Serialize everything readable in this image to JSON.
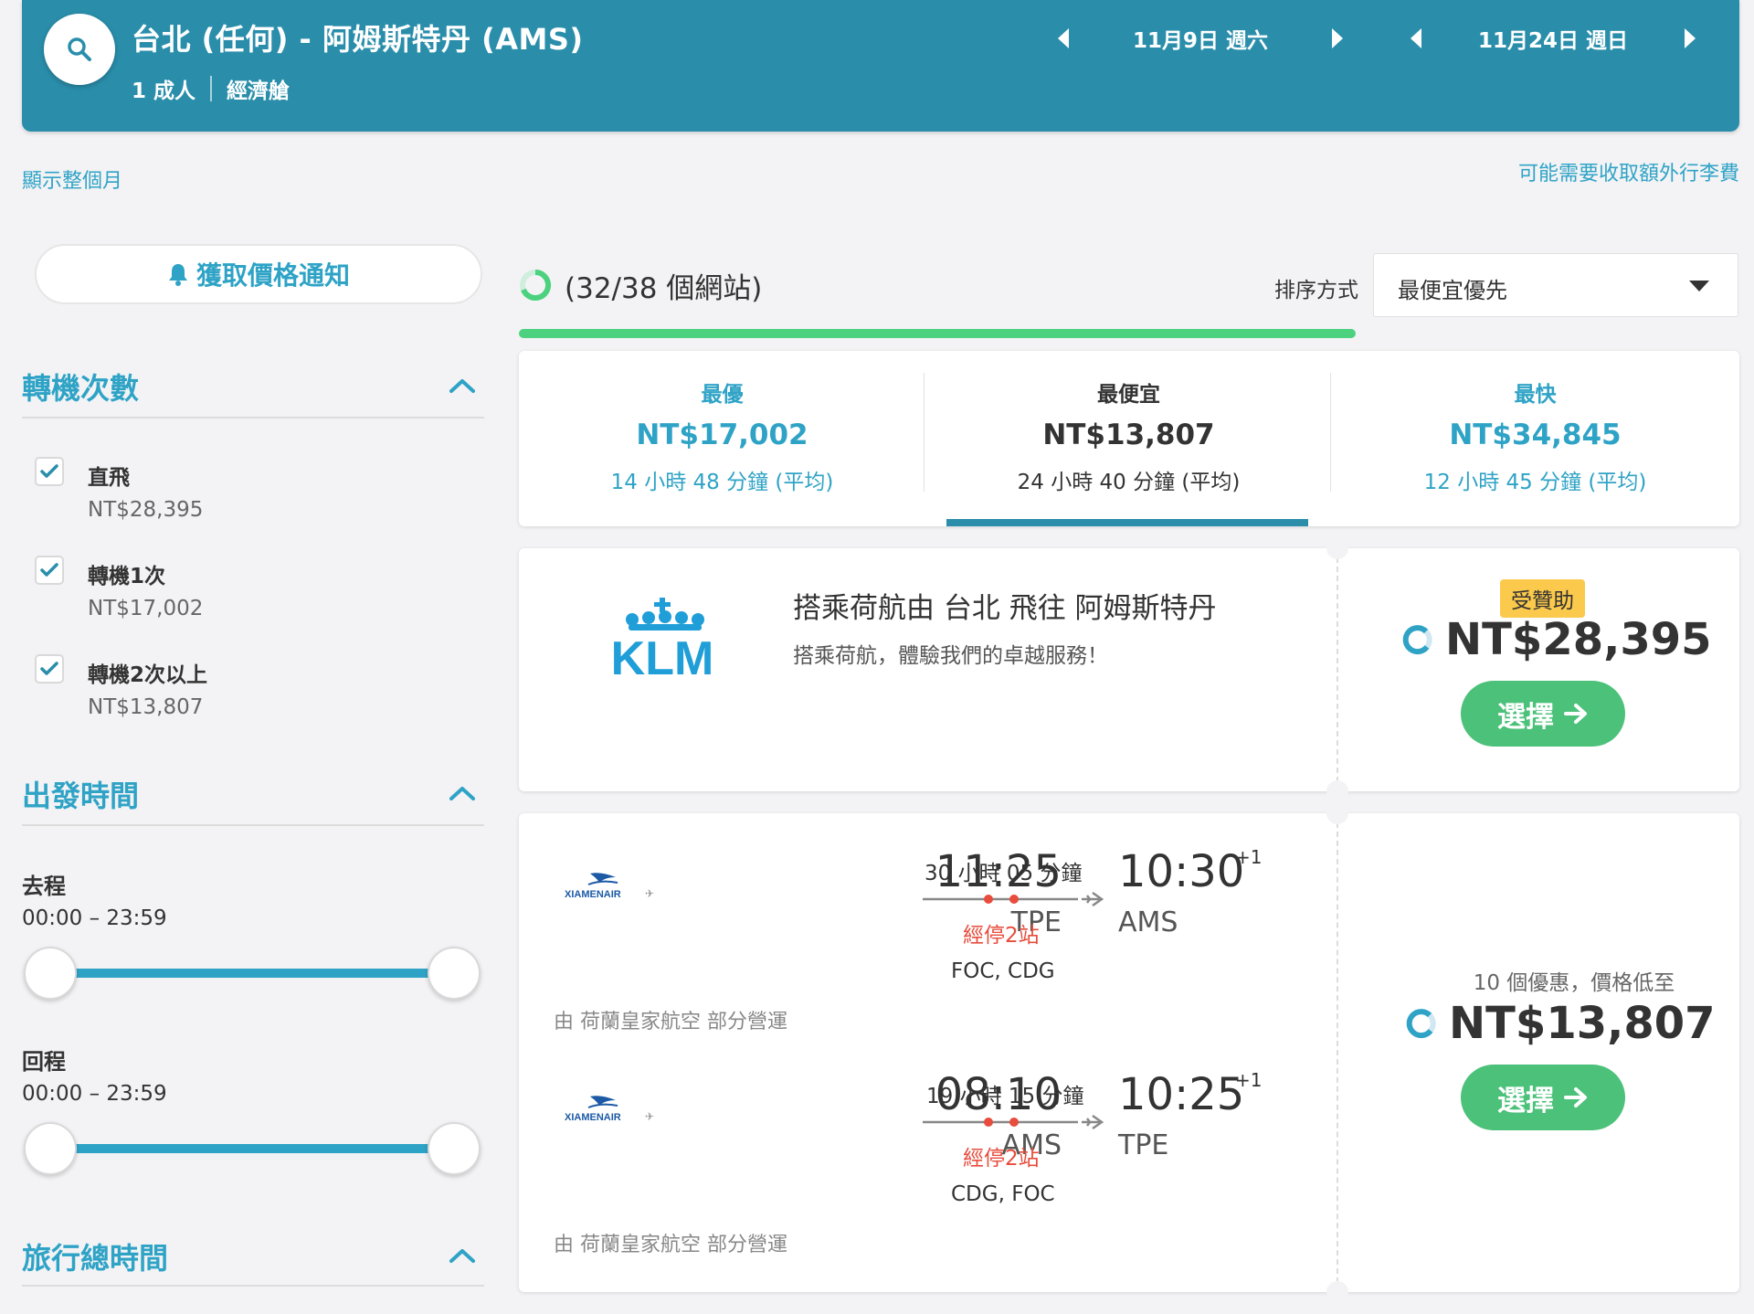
{
  "header": {
    "route": "台北 (任何) - 阿姆斯特丹 (AMS)",
    "passengers": "1 成人",
    "cabin": "經濟艙",
    "depart_date": "11月9日 週六",
    "return_date": "11月24日 週日"
  },
  "links": {
    "show_month": "顯示整個月",
    "baggage_fee": "可能需要收取額外行李費"
  },
  "sidebar": {
    "alert_button": "獲取價格通知",
    "stops_title": "轉機次數",
    "stops": [
      {
        "label": "直飛",
        "price": "NT$28,395",
        "checked": true
      },
      {
        "label": "轉機1次",
        "price": "NT$17,002",
        "checked": true
      },
      {
        "label": "轉機2次以上",
        "price": "NT$13,807",
        "checked": true
      }
    ],
    "departure_title": "出發時間",
    "outbound_label": "去程",
    "outbound_range": "00:00 – 23:59",
    "return_label": "回程",
    "return_range": "00:00 – 23:59",
    "duration_title": "旅行總時間"
  },
  "results": {
    "sites_status": "(32/38 個網站)",
    "progress_fraction": 0.686,
    "sort_label": "排序方式",
    "sort_value": "最便宜優先"
  },
  "tabs": [
    {
      "title": "最優",
      "price": "NT$17,002",
      "duration": "14 小時 48 分鐘 (平均)"
    },
    {
      "title": "最便宜",
      "price": "NT$13,807",
      "duration": "24 小時 40 分鐘 (平均)",
      "active": true
    },
    {
      "title": "最快",
      "price": "NT$34,845",
      "duration": "12 小時 45 分鐘 (平均)"
    }
  ],
  "ad": {
    "airline_logo": "KLM",
    "title": "搭乘荷航由 台北 飛往 阿姆斯特丹",
    "subtitle": "搭乘荷航，體驗我們的卓越服務！",
    "badge": "受贊助",
    "price": "NT$28,395",
    "button": "選擇"
  },
  "flight": {
    "airline_logo_text": "XIAMENAIR",
    "outbound": {
      "depart_time": "11:25",
      "depart_code": "TPE",
      "duration": "30 小時 05 分鐘",
      "stops": "經停2站",
      "via": "FOC, CDG",
      "arrive_time": "10:30",
      "day_offset": "+1",
      "arrive_code": "AMS"
    },
    "inbound": {
      "depart_time": "08:10",
      "depart_code": "AMS",
      "duration": "19 小時 15 分鐘",
      "stops": "經停2站",
      "via": "CDG, FOC",
      "arrive_time": "10:25",
      "day_offset": "+1",
      "arrive_code": "TPE"
    },
    "operated_by": "由 荷蘭皇家航空 部分營運",
    "deals": "10 個優惠，價格低至",
    "price": "NT$13,807",
    "button": "選擇"
  },
  "colors": {
    "header_bg": "#2a8eab",
    "accent_blue": "#2fa3c6",
    "green": "#4cc17a",
    "stop_red": "#e74c3c",
    "badge_yellow": "#fbc94b"
  }
}
